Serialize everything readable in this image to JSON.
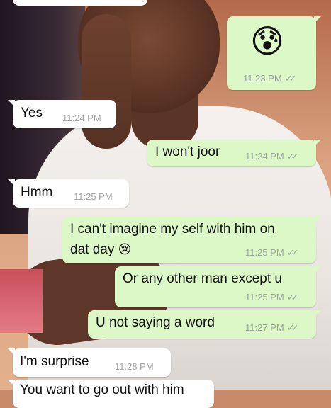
{
  "messages": [
    {
      "dir": "out",
      "emoji": "😰",
      "time": "11:23 PM",
      "ticks": "✓✓"
    },
    {
      "dir": "in",
      "text": "Yes",
      "time": "11:24 PM"
    },
    {
      "dir": "out",
      "text": "I won't joor",
      "time": "11:24 PM",
      "ticks": "✓✓"
    },
    {
      "dir": "in",
      "text": "Hmm",
      "time": "11:25 PM"
    },
    {
      "dir": "out",
      "line1": "I can't imagine my self with him on",
      "line2": "dat day",
      "emoji": "😢",
      "time": "11:25 PM",
      "ticks": "✓✓"
    },
    {
      "dir": "out",
      "text": "Or any other man except u",
      "time": "11:25 PM",
      "ticks": "✓✓"
    },
    {
      "dir": "out",
      "text": "U not saying a word",
      "time": "11:27 PM",
      "ticks": "✓✓"
    },
    {
      "dir": "in",
      "text": "I'm surprise",
      "time": "11:28 PM"
    },
    {
      "dir": "in",
      "text": "You want to go out with him"
    }
  ],
  "colors": {
    "outgoing": "#dcf8c6",
    "incoming": "#ffffff",
    "timestamp": "#9aa39b"
  }
}
